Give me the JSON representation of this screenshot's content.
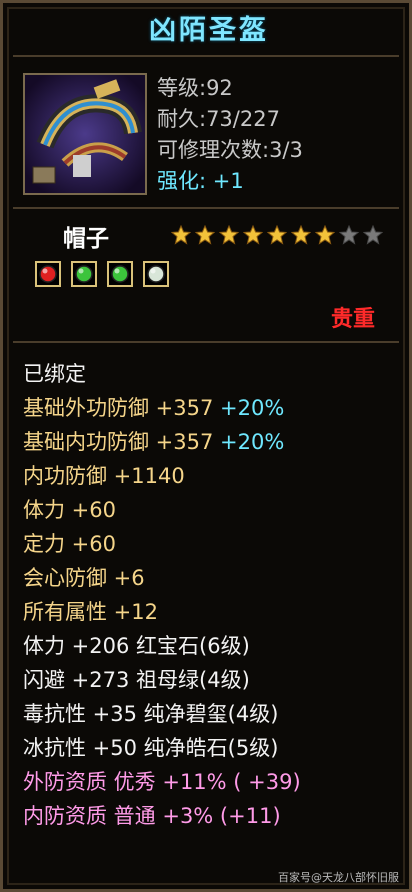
{
  "item": {
    "title": "凶陌圣盔",
    "level": "等级:92",
    "durability": "耐久:73/227",
    "repairs": "可修理次数:3/3",
    "enhance_label": "强化:",
    "enhance_value": "+1",
    "type": "帽子",
    "stars_filled": 7,
    "stars_total": 9,
    "rarity": "贵重",
    "gems": [
      "red-gem-icon",
      "green-gem-icon",
      "green-gem-icon",
      "white-gem-icon"
    ]
  },
  "attributes": [
    {
      "parts": [
        {
          "t": "已绑定",
          "c": "white"
        }
      ]
    },
    {
      "parts": [
        {
          "t": "基础外功防御 +357 ",
          "c": "gold"
        },
        {
          "t": "+20%",
          "c": "blue"
        }
      ]
    },
    {
      "parts": [
        {
          "t": "基础内功防御 +357 ",
          "c": "gold"
        },
        {
          "t": "+20%",
          "c": "blue"
        }
      ]
    },
    {
      "parts": [
        {
          "t": "内功防御 +1140",
          "c": "gold"
        }
      ]
    },
    {
      "parts": [
        {
          "t": "体力 +60",
          "c": "gold"
        }
      ]
    },
    {
      "parts": [
        {
          "t": "定力 +60",
          "c": "gold"
        }
      ]
    },
    {
      "parts": [
        {
          "t": "会心防御 +6",
          "c": "gold"
        }
      ]
    },
    {
      "parts": [
        {
          "t": "所有属性 +12",
          "c": "gold"
        }
      ]
    },
    {
      "parts": [
        {
          "t": "体力 +206 红宝石(6级)",
          "c": "white"
        }
      ]
    },
    {
      "parts": [
        {
          "t": "闪避 +273 祖母绿(4级)",
          "c": "white"
        }
      ]
    },
    {
      "parts": [
        {
          "t": "毒抗性 +35 纯净碧玺(4级)",
          "c": "white"
        }
      ]
    },
    {
      "parts": [
        {
          "t": "冰抗性 +50 纯净皓石(5级)",
          "c": "white"
        }
      ]
    },
    {
      "parts": [
        {
          "t": "外防资质  优秀  +11% ( +39)",
          "c": "pink"
        }
      ]
    },
    {
      "parts": [
        {
          "t": "内防资质  普通  +3% (+11)",
          "c": "pink"
        }
      ]
    }
  ],
  "watermark": "百家号@天龙八部怀旧服"
}
